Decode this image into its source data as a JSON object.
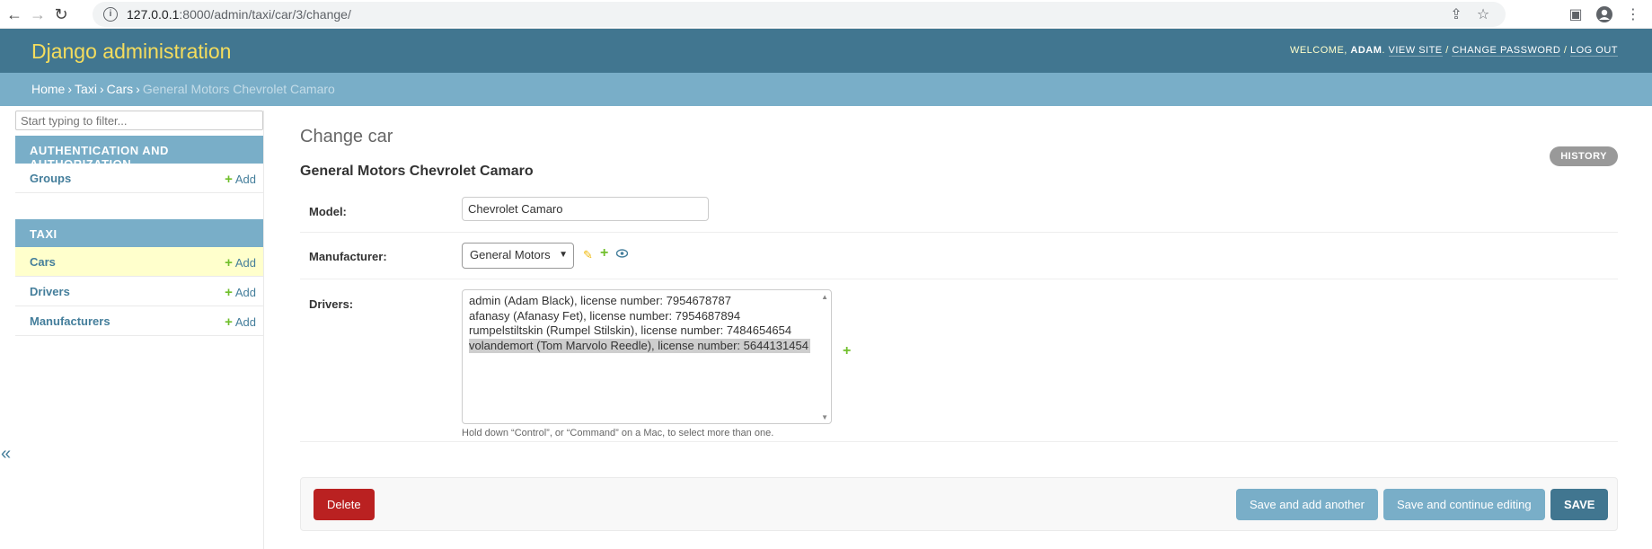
{
  "browser": {
    "url_host": "127.0.0.1",
    "url_rest": ":8000/admin/taxi/car/3/change/"
  },
  "header": {
    "branding": "Django administration",
    "welcome": "WELCOME, ",
    "username": "ADAM",
    "view_site": "VIEW SITE",
    "change_password": "CHANGE PASSWORD",
    "log_out": "LOG OUT"
  },
  "breadcrumbs": {
    "home": "Home",
    "taxi": "Taxi",
    "cars": "Cars",
    "current": "General Motors Chevrolet Camaro"
  },
  "sidebar": {
    "filter_placeholder": "Start typing to filter...",
    "modules": [
      {
        "caption": "AUTHENTICATION AND AUTHORIZATION",
        "rows": [
          {
            "name": "Groups",
            "add": "Add"
          }
        ]
      },
      {
        "caption": "TAXI",
        "rows": [
          {
            "name": "Cars",
            "add": "Add"
          },
          {
            "name": "Drivers",
            "add": "Add"
          },
          {
            "name": "Manufacturers",
            "add": "Add"
          }
        ]
      }
    ],
    "collapse": "«"
  },
  "content": {
    "title": "Change car",
    "history": "HISTORY",
    "object_name": "General Motors Chevrolet Camaro",
    "fields": {
      "model": {
        "label": "Model:",
        "value": "Chevrolet Camaro"
      },
      "manufacturer": {
        "label": "Manufacturer:",
        "value": "General Motors"
      },
      "drivers": {
        "label": "Drivers:",
        "options": [
          "admin (Adam Black), license number: 7954678787",
          "afanasy (Afanasy Fet), license number: 7954687894",
          "rumpelstiltskin (Rumpel Stilskin), license number: 7484654654",
          "volandemort (Tom Marvolo Reedle), license number: 5644131454"
        ],
        "help": "Hold down “Control”, or “Command” on a Mac, to select more than one."
      }
    },
    "buttons": {
      "delete": "Delete",
      "save_add_another": "Save and add another",
      "save_continue": "Save and continue editing",
      "save": "SAVE"
    }
  },
  "colors": {
    "header": "#417690",
    "breadcrumbs": "#79aec8",
    "branding": "#f5dd5d",
    "delete": "#ba2121",
    "add_green": "#70bf2b"
  }
}
